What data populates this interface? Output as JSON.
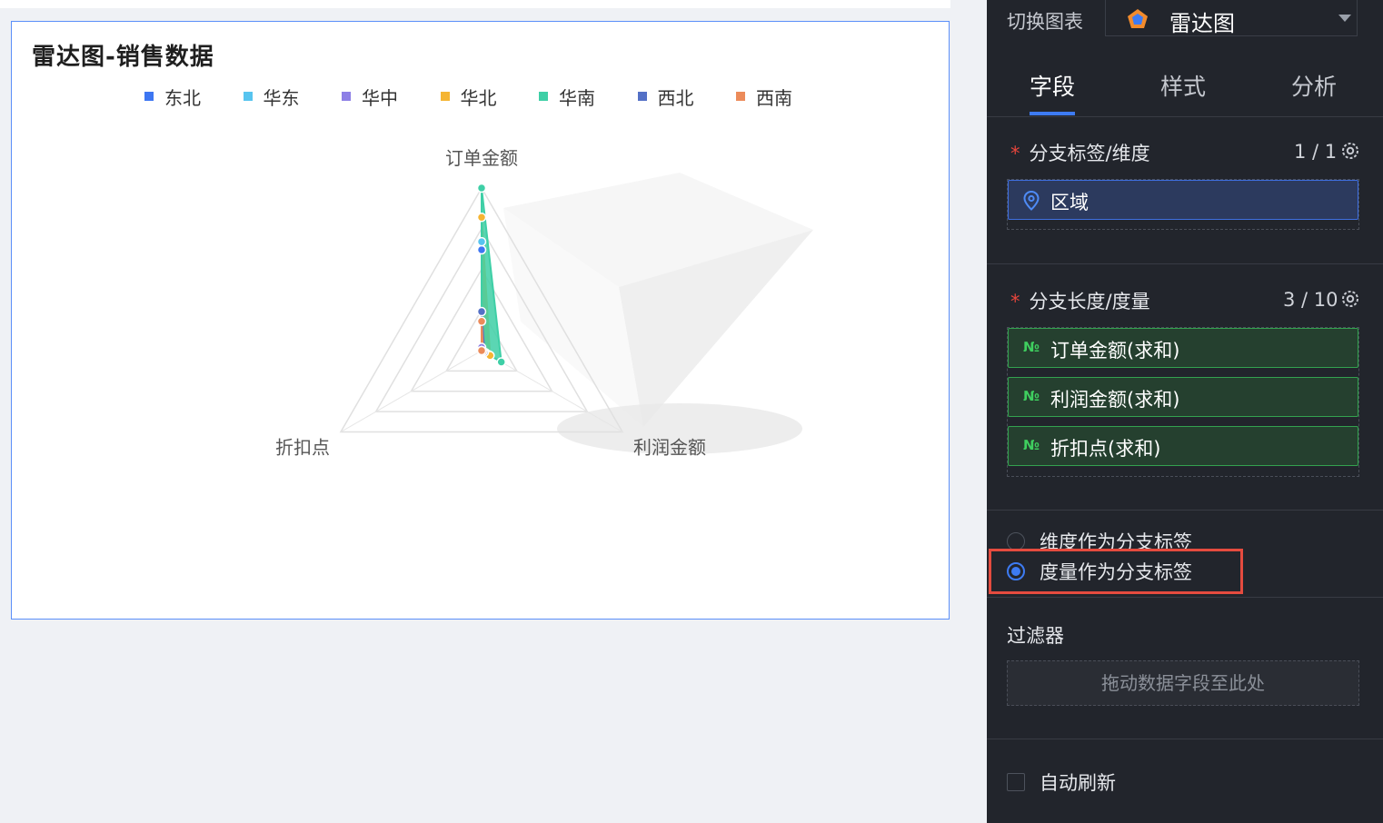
{
  "chart_panel": {
    "title": "雷达图-销售数据"
  },
  "chart_data": {
    "type": "radar",
    "title": "雷达图-销售数据",
    "axes": [
      "订单金额",
      "利润金额",
      "折扣点"
    ],
    "series": [
      {
        "name": "东北",
        "color": "#3d76f2",
        "values": [
          0.62,
          0.03,
          0.0
        ]
      },
      {
        "name": "华东",
        "color": "#57c4ef",
        "values": [
          0.67,
          0.05,
          0.0
        ]
      },
      {
        "name": "华中",
        "color": "#8d7fe6",
        "values": [
          0.02,
          0.03,
          0.0
        ]
      },
      {
        "name": "华北",
        "color": "#f5b533",
        "values": [
          0.82,
          0.06,
          0.0
        ]
      },
      {
        "name": "华南",
        "color": "#3ecfa6",
        "values": [
          1.0,
          0.14,
          0.0
        ]
      },
      {
        "name": "西北",
        "color": "#5470c6",
        "values": [
          0.24,
          0.02,
          0.0
        ]
      },
      {
        "name": "西南",
        "color": "#ec8b5a",
        "values": [
          0.18,
          0.01,
          0.0
        ]
      }
    ],
    "grid_levels": 4
  },
  "sidebar": {
    "switch_label": "切换图表",
    "chart_type": "雷达图",
    "tabs": [
      "字段",
      "样式",
      "分析"
    ],
    "dimension_section": {
      "title": "分支标签/维度",
      "count": "1 / 1",
      "field": "区域"
    },
    "measure_section": {
      "title": "分支长度/度量",
      "count": "3 / 10",
      "fields": [
        "订单金额(求和)",
        "利润金额(求和)",
        "折扣点(求和)"
      ],
      "field_icon": "№"
    },
    "radio_options": [
      "维度作为分支标签",
      "度量作为分支标签"
    ],
    "selected_radio": 1,
    "filter": {
      "title": "过滤器",
      "placeholder": "拖动数据字段至此处"
    },
    "auto_refresh": "自动刷新"
  },
  "colors": {
    "accent": "#3d7bf3",
    "highlight": "#e54b3f",
    "panel_bg": "#22252c"
  }
}
